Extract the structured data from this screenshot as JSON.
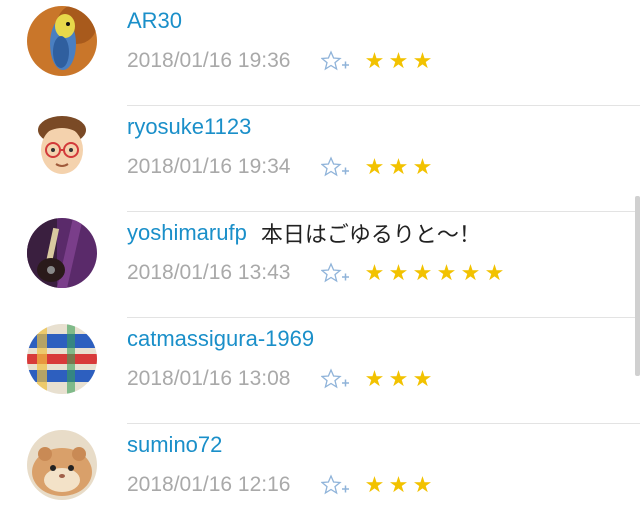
{
  "colors": {
    "username": "#1a8fc9",
    "timestamp": "#a9a9a9",
    "star": "#f2c200",
    "star_add": "#8fb3d9"
  },
  "star_glyph": "★",
  "entries": [
    {
      "username": "AR30",
      "comment": "",
      "timestamp": "2018/01/16 19:36",
      "star_count": 3,
      "avatar_icon": "parakeet-photo"
    },
    {
      "username": "ryosuke1123",
      "comment": "",
      "timestamp": "2018/01/16 19:34",
      "star_count": 3,
      "avatar_icon": "cartoon-face-with-glasses"
    },
    {
      "username": "yoshimarufp",
      "comment": "本日はごゆるりと～！",
      "timestamp": "2018/01/16 13:43",
      "star_count": 6,
      "avatar_icon": "guitar-photo"
    },
    {
      "username": "catmassigura-1969",
      "comment": "",
      "timestamp": "2018/01/16 13:08",
      "star_count": 3,
      "avatar_icon": "colorful-pattern-photo"
    },
    {
      "username": "sumino72",
      "comment": "",
      "timestamp": "2018/01/16 12:16",
      "star_count": 3,
      "avatar_icon": "hamster-photo"
    }
  ]
}
